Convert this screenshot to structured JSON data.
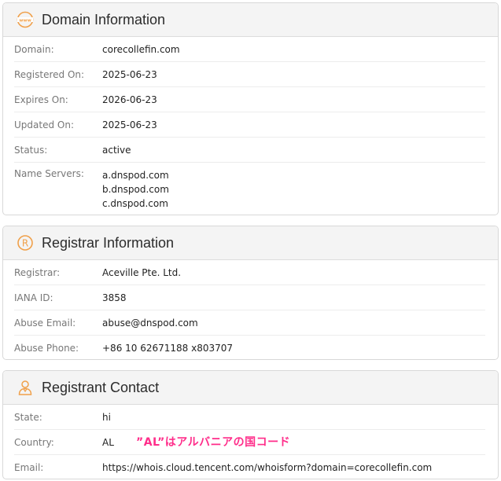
{
  "domain_info": {
    "title": "Domain Information",
    "icon": "www-globe-icon",
    "rows": [
      {
        "label": "Domain:",
        "value": "corecollefin.com"
      },
      {
        "label": "Registered On:",
        "value": "2025-06-23"
      },
      {
        "label": "Expires On:",
        "value": "2026-06-23"
      },
      {
        "label": "Updated On:",
        "value": "2025-06-23"
      },
      {
        "label": "Status:",
        "value": "active"
      }
    ],
    "name_servers_label": "Name Servers:",
    "name_servers": [
      "a.dnspod.com",
      "b.dnspod.com",
      "c.dnspod.com"
    ]
  },
  "registrar_info": {
    "title": "Registrar Information",
    "icon": "registered-icon",
    "rows": [
      {
        "label": "Registrar:",
        "value": "Aceville Pte. Ltd."
      },
      {
        "label": "IANA ID:",
        "value": "3858"
      },
      {
        "label": "Abuse Email:",
        "value": "abuse@dnspod.com"
      },
      {
        "label": "Abuse Phone:",
        "value": "+86 10 62671188 x803707"
      }
    ]
  },
  "registrant_contact": {
    "title": "Registrant Contact",
    "icon": "person-icon",
    "rows": [
      {
        "label": "State:",
        "value": "hi"
      },
      {
        "label": "Country:",
        "value": "AL"
      },
      {
        "label": "Email:",
        "value": "https://whois.cloud.tencent.com/whoisform?domain=corecollefin.com"
      }
    ]
  },
  "annotation": "”AL”はアルバニアの国コード",
  "colors": {
    "accent_icon": "#f0a04a",
    "annotation": "#ff2d8a"
  }
}
